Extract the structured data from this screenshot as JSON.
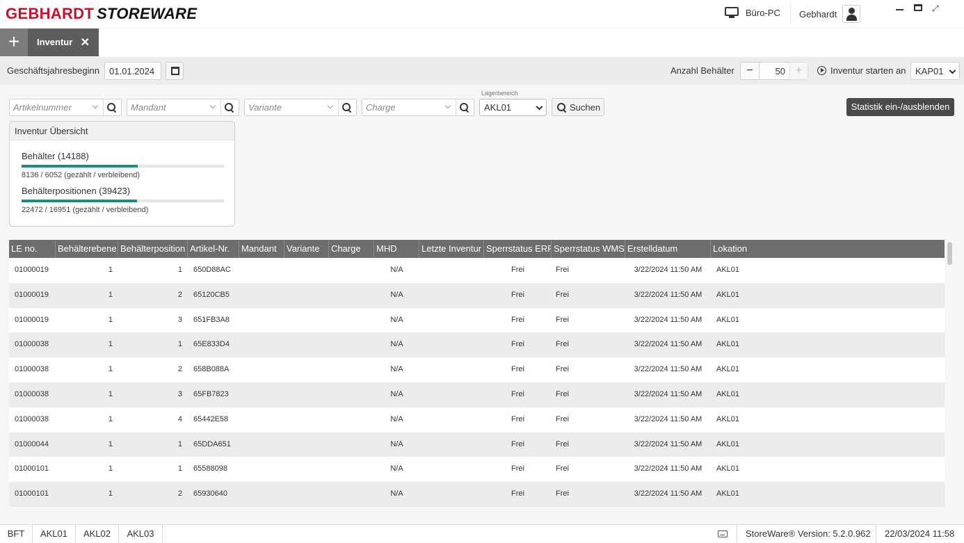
{
  "header": {
    "logo_part1": "GEBHARDT",
    "logo_part2": "STOREWARE",
    "computer": "Büro-PC",
    "user": "Gebhardt"
  },
  "tabs": {
    "add_label": "+",
    "active_label": "Inventur",
    "close_label": "✕"
  },
  "toolbar": {
    "fiscal_label": "Geschäftsjahresbeginn",
    "fiscal_value": "01.01.2024",
    "count_label": "Anzahl Behälter",
    "count_value": "50",
    "minus": "−",
    "plus": "+",
    "start_label": "Inventur starten an",
    "start_value": "KAP01"
  },
  "filters": {
    "artikel_placeholder": "Artikelnummer",
    "mandant_placeholder": "Mandant",
    "variante_placeholder": "Variante",
    "charge_placeholder": "Charge",
    "lager_label": "Lagerbereich",
    "lager_value": "AKL01",
    "search_label": "Suchen",
    "stat_toggle_label": "Statistik ein-/ausblenden"
  },
  "overview": {
    "title": "Inventur Übersicht",
    "containers": {
      "title": "Behälter (14188)",
      "detail": "8136 / 6052 (gezählt / verbleibend)",
      "progress": 0.573
    },
    "positions": {
      "title": "Behälterpositionen (39423)",
      "detail": "22472 / 16951 (gezählt / verbleibend)",
      "progress": 0.57
    }
  },
  "table": {
    "columns": [
      "LE no.",
      "Behälterebene",
      "Behälterposition",
      "Artikel-Nr.",
      "Mandant",
      "Variante",
      "Charge",
      "MHD",
      "Letzte Inventur",
      "Sperrstatus ERP",
      "Sperrstatus WMS",
      "Erstelldatum",
      "Lokation"
    ],
    "rows": [
      [
        "01000019",
        "1",
        "1",
        "650D88AC",
        "",
        "",
        "",
        "N/A",
        "",
        "Frei",
        "Frei",
        "3/22/2024 11:50 AM",
        "AKL01"
      ],
      [
        "01000019",
        "1",
        "2",
        "65120CB5",
        "",
        "",
        "",
        "N/A",
        "",
        "Frei",
        "Frei",
        "3/22/2024 11:50 AM",
        "AKL01"
      ],
      [
        "01000019",
        "1",
        "3",
        "651FB3A8",
        "",
        "",
        "",
        "N/A",
        "",
        "Frei",
        "Frei",
        "3/22/2024 11:50 AM",
        "AKL01"
      ],
      [
        "01000038",
        "1",
        "1",
        "65E833D4",
        "",
        "",
        "",
        "N/A",
        "",
        "Frei",
        "Frei",
        "3/22/2024 11:50 AM",
        "AKL01"
      ],
      [
        "01000038",
        "1",
        "2",
        "658B088A",
        "",
        "",
        "",
        "N/A",
        "",
        "Frei",
        "Frei",
        "3/22/2024 11:50 AM",
        "AKL01"
      ],
      [
        "01000038",
        "1",
        "3",
        "65FB7823",
        "",
        "",
        "",
        "N/A",
        "",
        "Frei",
        "Frei",
        "3/22/2024 11:50 AM",
        "AKL01"
      ],
      [
        "01000038",
        "1",
        "4",
        "65442E58",
        "",
        "",
        "",
        "N/A",
        "",
        "Frei",
        "Frei",
        "3/22/2024 11:50 AM",
        "AKL01"
      ],
      [
        "01000044",
        "1",
        "1",
        "65DDA651",
        "",
        "",
        "",
        "N/A",
        "",
        "Frei",
        "Frei",
        "3/22/2024 11:50 AM",
        "AKL01"
      ],
      [
        "01000101",
        "1",
        "1",
        "65588098",
        "",
        "",
        "",
        "N/A",
        "",
        "Frei",
        "Frei",
        "3/22/2024 11:50 AM",
        "AKL01"
      ],
      [
        "01000101",
        "1",
        "2",
        "65930640",
        "",
        "",
        "",
        "N/A",
        "",
        "Frei",
        "Frei",
        "3/22/2024 11:50 AM",
        "AKL01"
      ]
    ]
  },
  "footer": {
    "tabs": [
      "BFT",
      "AKL01",
      "AKL02",
      "AKL03"
    ],
    "version": "StoreWare® Version: 5.2.0.962",
    "datetime": "22/03/2024 11:58"
  },
  "colors": {
    "brand_red": "#c8102e",
    "progress_teal": "#1f8a7d",
    "table_header": "#6d6d6d"
  }
}
